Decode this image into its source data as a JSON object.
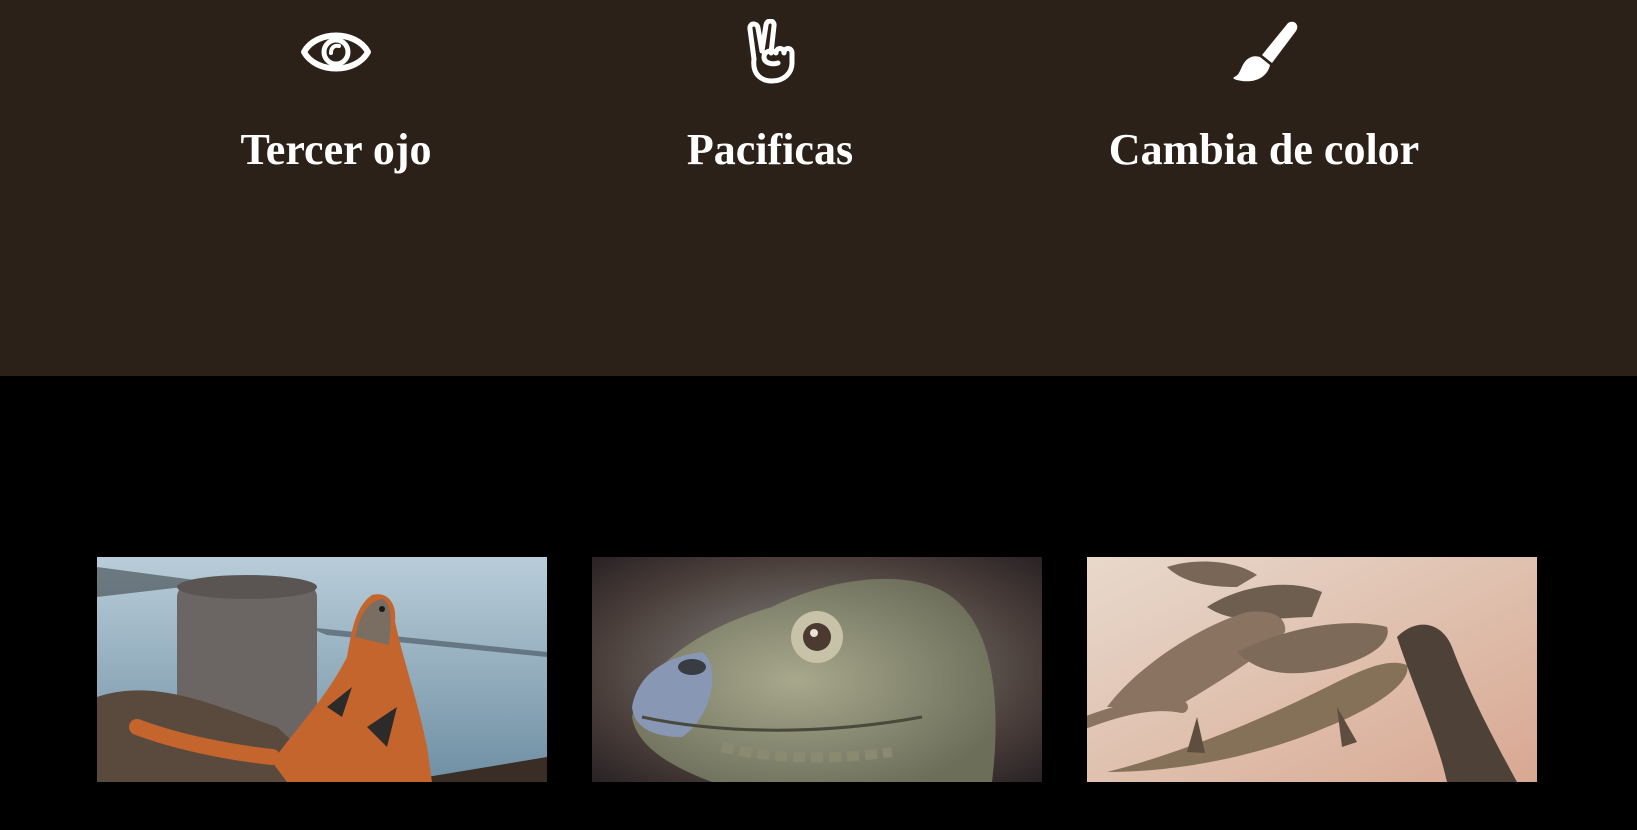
{
  "features": [
    {
      "title": "Tercer ojo",
      "icon": "eye-icon"
    },
    {
      "title": "Pacificas",
      "icon": "peace-hand-icon"
    },
    {
      "title": "Cambia de color",
      "icon": "paint-brush-icon"
    }
  ],
  "gallery": {
    "images": [
      {
        "subject": "orange-iguana-by-water"
      },
      {
        "subject": "iguana-head-closeup"
      },
      {
        "subject": "group-of-iguanas-on-sand"
      }
    ]
  },
  "colors": {
    "features_background": "#2c2119",
    "gallery_background": "#000000",
    "text": "#ffffff"
  }
}
